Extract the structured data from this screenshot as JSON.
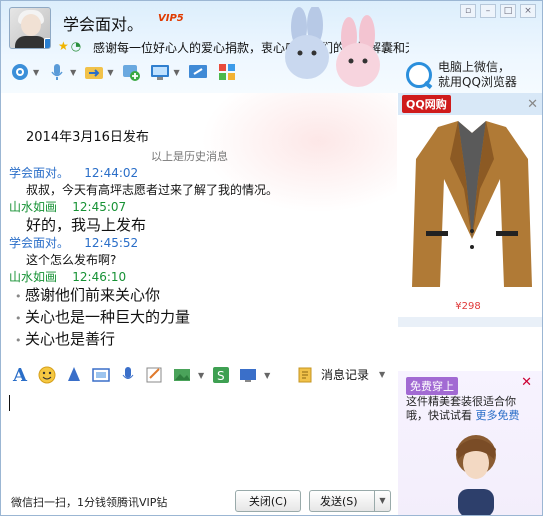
{
  "header": {
    "title": "学会面对。",
    "vip": "VIP5",
    "signature": "感谢每一位好心人的爱心捐款，衷心感谢你们的慷慨解囊和无私的帮助，让我的心…",
    "window_controls": [
      "minimize-icon",
      "maximize-icon",
      "close-icon"
    ],
    "promo_text_line1": "电脑上微信，",
    "promo_text_line2": "就用QQ浏览器"
  },
  "toolbar": {
    "items": [
      "camera-icon",
      "microphone-icon",
      "file-transfer-icon",
      "add-contact-icon",
      "remote-desktop-icon",
      "share-screen-icon",
      "app-grid-icon"
    ]
  },
  "chat": {
    "date": "2014年3月16日发布",
    "history_line": "以上是历史消息",
    "messages": [
      {
        "sender": "学会面对。",
        "time": "12:44:02",
        "role": "me",
        "text": "叔叔，今天有高坪志愿者过来了解了我的情况。",
        "size": "normal"
      },
      {
        "sender": "山水如画",
        "time": "12:45:07",
        "role": "other",
        "text": "好的，我马上发布",
        "size": "big"
      },
      {
        "sender": "学会面对。",
        "time": "12:45:52",
        "role": "me",
        "text": "这个怎么发布啊?",
        "size": "normal"
      },
      {
        "sender": "山水如画",
        "time": "12:46:10",
        "role": "other",
        "lines": [
          "感谢他们前来关心你",
          "关心也是一种巨大的力量",
          "关心也是善行"
        ]
      }
    ]
  },
  "ad_top": {
    "brand": "QQ网购",
    "price": "¥298"
  },
  "editor": {
    "history_label": "消息记录"
  },
  "bottom": {
    "left_text": "微信扫一扫，1分钱领腾讯VIP钻",
    "close_label": "关闭(C)",
    "send_label": "发送(S)"
  },
  "ad_bottom": {
    "badge": "免费穿上",
    "desc_prefix": "这件精美套装很适合你哦，快试试看 ",
    "link": "更多免费"
  },
  "colors": {
    "accent": "#2a6ec8",
    "other": "#179235",
    "price": "#e03a3a"
  }
}
